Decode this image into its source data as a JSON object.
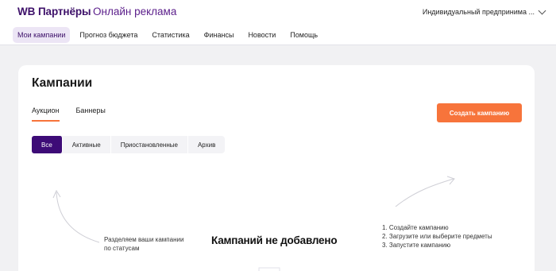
{
  "header": {
    "brand": "WB Партнёры",
    "section": "Онлайн реклама",
    "account": "Индивидуальный предпринима ..."
  },
  "nav": [
    {
      "label": "Мои кампании",
      "active": true
    },
    {
      "label": "Прогноз бюджета",
      "active": false
    },
    {
      "label": "Статистика",
      "active": false
    },
    {
      "label": "Финансы",
      "active": false
    },
    {
      "label": "Новости",
      "active": false
    },
    {
      "label": "Помощь",
      "active": false
    }
  ],
  "page": {
    "title": "Кампании",
    "tabs": [
      {
        "label": "Аукцион",
        "active": true
      },
      {
        "label": "Баннеры",
        "active": false
      }
    ],
    "create_button": "Создать кампанию",
    "filters": [
      {
        "label": "Все",
        "active": true
      },
      {
        "label": "Активные",
        "active": false
      },
      {
        "label": "Приостановленные",
        "active": false
      },
      {
        "label": "Архив",
        "active": false
      }
    ],
    "empty": {
      "title": "Кампаний не добавлено",
      "hint": "Разделяем ваши кампании по статусам",
      "steps": [
        "1. Создайте кампанию",
        "2. Загрузите или выберите предметы",
        "3. Запустите кампанию"
      ]
    }
  },
  "colors": {
    "brand": "#3d1069",
    "accent": "#f7743b",
    "active_filter": "#3d0b77",
    "active_nav_bg": "#ece5f5"
  }
}
